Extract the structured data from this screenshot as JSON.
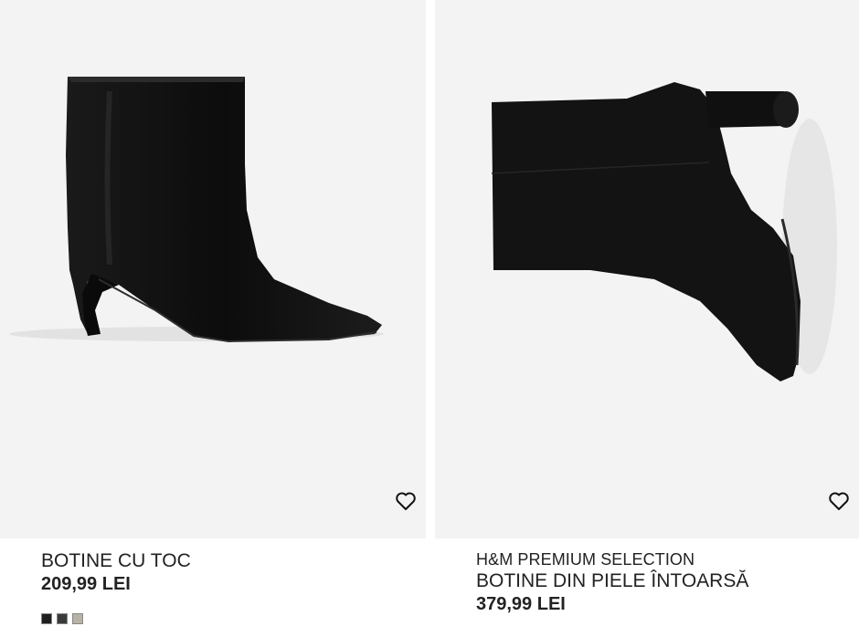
{
  "products": [
    {
      "title": "BOTINE CU TOC",
      "price": "209,99 LEI",
      "swatches": [
        "#1f1f1f",
        "#3a3a3a",
        "#b9b3a6"
      ],
      "favorite_icon": "heart-outline-icon",
      "image_icon": "heeled-ankle-boot-image"
    },
    {
      "brand": "H&M PREMIUM SELECTION",
      "title": "BOTINE DIN PIELE ÎNTOARSĂ",
      "price": "379,99 LEI",
      "favorite_icon": "heart-outline-icon",
      "image_icon": "suede-ankle-boot-image"
    }
  ],
  "colors": {
    "image_bg": "#f3f3f3",
    "text": "#222222",
    "boot": "#111111"
  }
}
